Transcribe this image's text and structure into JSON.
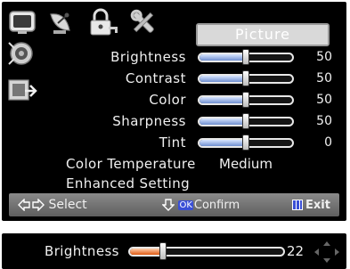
{
  "menu": {
    "header": "Picture",
    "top_icons": [
      "tv-icon",
      "satellite-dish-icon",
      "lock-icon",
      "tools-icon"
    ],
    "side_icons": [
      "speaker-icon",
      "setup-icon"
    ],
    "sliders": [
      {
        "label": "Brightness",
        "value": "50",
        "level": 0.5
      },
      {
        "label": "Contrast",
        "value": "50",
        "level": 0.5
      },
      {
        "label": "Color",
        "value": "50",
        "level": 0.5
      },
      {
        "label": "Sharpness",
        "value": "50",
        "level": 0.5
      },
      {
        "label": "Tint",
        "value": "0",
        "level": 0.5
      }
    ],
    "color_temperature": {
      "label": "Color Temperature",
      "value": "Medium"
    },
    "enhanced_setting": {
      "label": "Enhanced Setting"
    },
    "footer": {
      "select_label": "Select",
      "ok_badge": "OK",
      "confirm_label": "Confirm",
      "exit_label": "Exit"
    }
  },
  "quick_bar": {
    "label": "Brightness",
    "value": "22",
    "level": 0.22
  },
  "colors": {
    "background": "#000000",
    "header_bg": "#d9d9d9",
    "slider_fill": "#6f8fd0",
    "quick_fill": "#e05a12",
    "footer_bg": "#707070",
    "ok_blue": "#3a4fd6"
  }
}
